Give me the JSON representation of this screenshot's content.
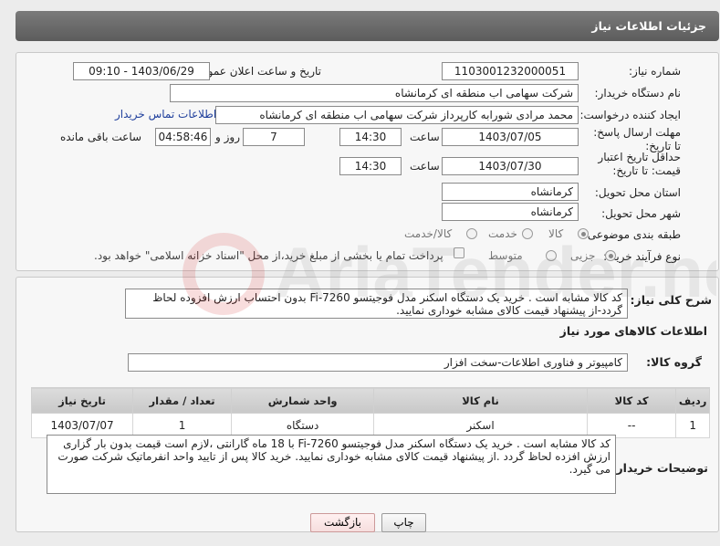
{
  "header": {
    "title": "جزئیات اطلاعات نیاز"
  },
  "form": {
    "need_number_label": "شماره نیاز:",
    "need_number": "1103001232000051",
    "announce_label": "تاریخ و ساعت اعلان عمومی:",
    "announce_value": "1403/06/29 - 09:10",
    "buyer_label": "نام دستگاه خریدار:",
    "buyer_value": "شرکت سهامی اب منطقه ای کرمانشاه",
    "creator_label": "ایجاد کننده درخواست:",
    "creator_value": "محمد مرادی شورابه کارپرداز شرکت سهامی اب منطقه ای کرمانشاه",
    "contact_link": "اطلاعات تماس خریدار",
    "deadline_label": "مهلت ارسال پاسخ: تا تاریخ:",
    "deadline_date": "1403/07/05",
    "time_label": "ساعت",
    "deadline_time": "14:30",
    "days_value": "7",
    "days_label": "روز و",
    "remaining_time": "04:58:46",
    "remaining_label": "ساعت باقی مانده",
    "validity_label": "حداقل تاریخ اعتبار قیمت: تا تاریخ:",
    "validity_date": "1403/07/30",
    "validity_time": "14:30",
    "province_label": "استان محل تحویل:",
    "province_value": "کرمانشاه",
    "city_label": "شهر محل تحویل:",
    "city_value": "کرمانشاه",
    "category_label": "طبقه بندی موضوعی:",
    "category_options": [
      "کالا",
      "خدمت",
      "کالا/خدمت"
    ],
    "category_selected": "کالا",
    "process_label": "نوع فرآیند خرید :",
    "process_options": [
      "جزیی",
      "متوسط"
    ],
    "process_selected": "جزیی",
    "payment_note": "پرداخت تمام یا بخشی از مبلغ خرید،از محل \"اسناد خزانه اسلامی\" خواهد بود."
  },
  "description": {
    "label": "شرح کلی نیاز:",
    "text": "کد کالا مشابه است . خرید یک دستگاه اسکنر مدل فوجیتسو Fi-7260 بدون احتساب ارزش افزوده لحاظ گردد-از پیشنهاد قیمت کالای مشابه خوداری نمایید."
  },
  "goods": {
    "section_title": "اطلاعات کالاهای مورد نیاز",
    "group_label": "گروه کالا:",
    "group_value": "کامپیوتر و فناوری اطلاعات-سخت افزار",
    "columns": [
      "ردیف",
      "کد کالا",
      "نام کالا",
      "واحد شمارش",
      "تعداد / مقدار",
      "تاریخ نیاز"
    ],
    "rows": [
      [
        "1",
        "--",
        "اسکنر",
        "دستگاه",
        "1",
        "1403/07/07"
      ]
    ]
  },
  "buyer_notes": {
    "label": "توضیحات خریدار:",
    "text": "کد کالا مشابه است . خرید یک دستگاه اسکنر مدل فوجیتسو Fi-7260 با 18 ماه گارانتی ،لازم است قیمت بدون بار گزاری ارزش افزده لحاظ گردد .از پیشنهاد قیمت کالای مشابه خوداری نمایید. خرید کالا پس از تایید واحد انفرماتیک شرکت صورت می گیرد."
  },
  "buttons": {
    "print": "چاپ",
    "back": "بازگشت"
  },
  "watermark": {
    "text": "AriaTender.net"
  }
}
